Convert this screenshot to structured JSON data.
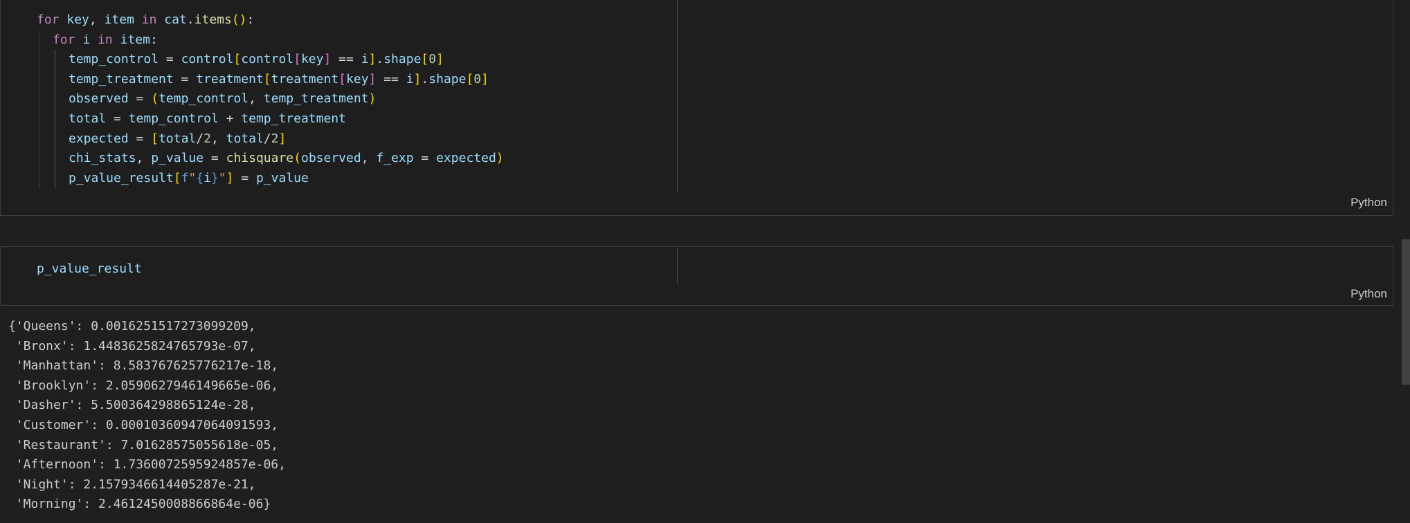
{
  "cell1": {
    "language": "Python",
    "lines": [
      {
        "indent": 0,
        "tokens": [
          [
            "kw",
            "for"
          ],
          [
            "op",
            " "
          ],
          [
            "var",
            "key"
          ],
          [
            "op",
            ", "
          ],
          [
            "var",
            "item"
          ],
          [
            "op",
            " "
          ],
          [
            "kw",
            "in"
          ],
          [
            "op",
            " "
          ],
          [
            "var",
            "cat"
          ],
          [
            "op",
            "."
          ],
          [
            "fn",
            "items"
          ],
          [
            "br1",
            "()"
          ],
          [
            "op",
            ":"
          ]
        ]
      },
      {
        "indent": 1,
        "tokens": [
          [
            "kw",
            "for"
          ],
          [
            "op",
            " "
          ],
          [
            "var",
            "i"
          ],
          [
            "op",
            " "
          ],
          [
            "kw",
            "in"
          ],
          [
            "op",
            " "
          ],
          [
            "var",
            "item"
          ],
          [
            "op",
            ":"
          ]
        ]
      },
      {
        "indent": 2,
        "tokens": [
          [
            "var",
            "temp_control"
          ],
          [
            "op",
            " = "
          ],
          [
            "var",
            "control"
          ],
          [
            "br1",
            "["
          ],
          [
            "var",
            "control"
          ],
          [
            "br2",
            "["
          ],
          [
            "var",
            "key"
          ],
          [
            "br2",
            "]"
          ],
          [
            "op",
            " == "
          ],
          [
            "var",
            "i"
          ],
          [
            "br1",
            "]"
          ],
          [
            "op",
            "."
          ],
          [
            "var",
            "shape"
          ],
          [
            "br1",
            "["
          ],
          [
            "num",
            "0"
          ],
          [
            "br1",
            "]"
          ]
        ]
      },
      {
        "indent": 2,
        "tokens": [
          [
            "var",
            "temp_treatment"
          ],
          [
            "op",
            " = "
          ],
          [
            "var",
            "treatment"
          ],
          [
            "br1",
            "["
          ],
          [
            "var",
            "treatment"
          ],
          [
            "br2",
            "["
          ],
          [
            "var",
            "key"
          ],
          [
            "br2",
            "]"
          ],
          [
            "op",
            " == "
          ],
          [
            "var",
            "i"
          ],
          [
            "br1",
            "]"
          ],
          [
            "op",
            "."
          ],
          [
            "var",
            "shape"
          ],
          [
            "br1",
            "["
          ],
          [
            "num",
            "0"
          ],
          [
            "br1",
            "]"
          ]
        ]
      },
      {
        "indent": 2,
        "tokens": [
          [
            "var",
            "observed"
          ],
          [
            "op",
            " = "
          ],
          [
            "br1",
            "("
          ],
          [
            "var",
            "temp_control"
          ],
          [
            "op",
            ", "
          ],
          [
            "var",
            "temp_treatment"
          ],
          [
            "br1",
            ")"
          ]
        ]
      },
      {
        "indent": 2,
        "tokens": [
          [
            "var",
            "total"
          ],
          [
            "op",
            " = "
          ],
          [
            "var",
            "temp_control"
          ],
          [
            "op",
            " + "
          ],
          [
            "var",
            "temp_treatment"
          ]
        ]
      },
      {
        "indent": 2,
        "tokens": [
          [
            "var",
            "expected"
          ],
          [
            "op",
            " = "
          ],
          [
            "br1",
            "["
          ],
          [
            "var",
            "total"
          ],
          [
            "op",
            "/"
          ],
          [
            "num",
            "2"
          ],
          [
            "op",
            ", "
          ],
          [
            "var",
            "total"
          ],
          [
            "op",
            "/"
          ],
          [
            "num",
            "2"
          ],
          [
            "br1",
            "]"
          ]
        ]
      },
      {
        "indent": 2,
        "tokens": [
          [
            "var",
            "chi_stats"
          ],
          [
            "op",
            ", "
          ],
          [
            "var",
            "p_value"
          ],
          [
            "op",
            " = "
          ],
          [
            "fn",
            "chisquare"
          ],
          [
            "br1",
            "("
          ],
          [
            "var",
            "observed"
          ],
          [
            "op",
            ", "
          ],
          [
            "var",
            "f_exp"
          ],
          [
            "op",
            " = "
          ],
          [
            "var",
            "expected"
          ],
          [
            "br1",
            ")"
          ]
        ]
      },
      {
        "indent": 2,
        "tokens": [
          [
            "var",
            "p_value_result"
          ],
          [
            "br1",
            "["
          ],
          [
            "kw2",
            "f"
          ],
          [
            "str",
            "\""
          ],
          [
            "kw2",
            "{"
          ],
          [
            "var",
            "i"
          ],
          [
            "kw2",
            "}"
          ],
          [
            "str",
            "\""
          ],
          [
            "br1",
            "]"
          ],
          [
            "op",
            " = "
          ],
          [
            "var",
            "p_value"
          ]
        ]
      }
    ]
  },
  "cell2": {
    "language": "Python",
    "code": "p_value_result"
  },
  "output": {
    "lines": [
      "{'Queens': 0.0016251517273099209,",
      " 'Bronx': 1.4483625824765793e-07,",
      " 'Manhattan': 8.583767625776217e-18,",
      " 'Brooklyn': 2.0590627946149665e-06,",
      " 'Dasher': 5.500364298865124e-28,",
      " 'Customer': 0.00010360947064091593,",
      " 'Restaurant': 7.01628575055618e-05,",
      " 'Afternoon': 1.7360072595924857e-06,",
      " 'Night': 2.1579346614405287e-21,",
      " 'Morning': 2.4612450008866864e-06}"
    ]
  }
}
